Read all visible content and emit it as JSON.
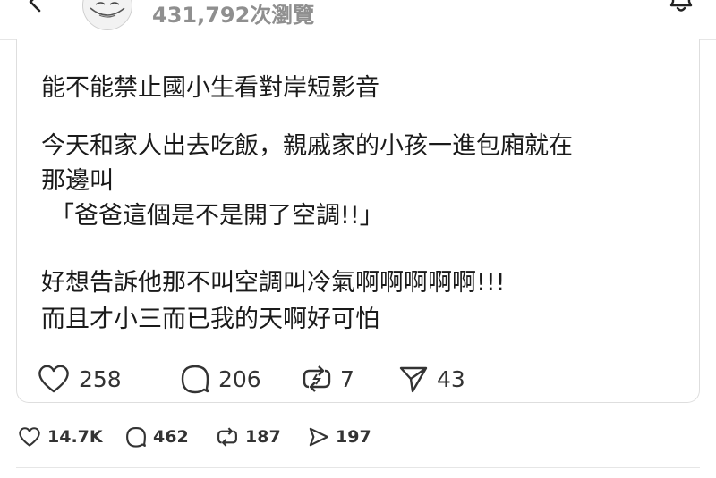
{
  "header": {
    "view_count": "431,792次瀏覽",
    "icons": [
      "chevron-left-icon",
      "avatar",
      "bell-icon"
    ]
  },
  "post": {
    "lines": [
      "能不能禁止國小生看對岸短影音",
      "今天和家人出去吃飯，親戚家的小孩一進包廂就在",
      "那邊叫",
      "「爸爸這個是不是開了空調!!」",
      "好想告訴他那不叫空調叫冷氣啊啊啊啊啊!!!",
      "而且才小三而已我的天啊好可怕"
    ],
    "stats": {
      "likes": "258",
      "comments": "206",
      "reposts": "7",
      "shares": "43"
    }
  },
  "thread_stats": {
    "likes": "14.7K",
    "comments": "462",
    "reposts": "187",
    "shares": "197"
  },
  "colors": {
    "text": "#1a1a1a",
    "muted": "#8f8f8f",
    "border": "#dedede"
  }
}
